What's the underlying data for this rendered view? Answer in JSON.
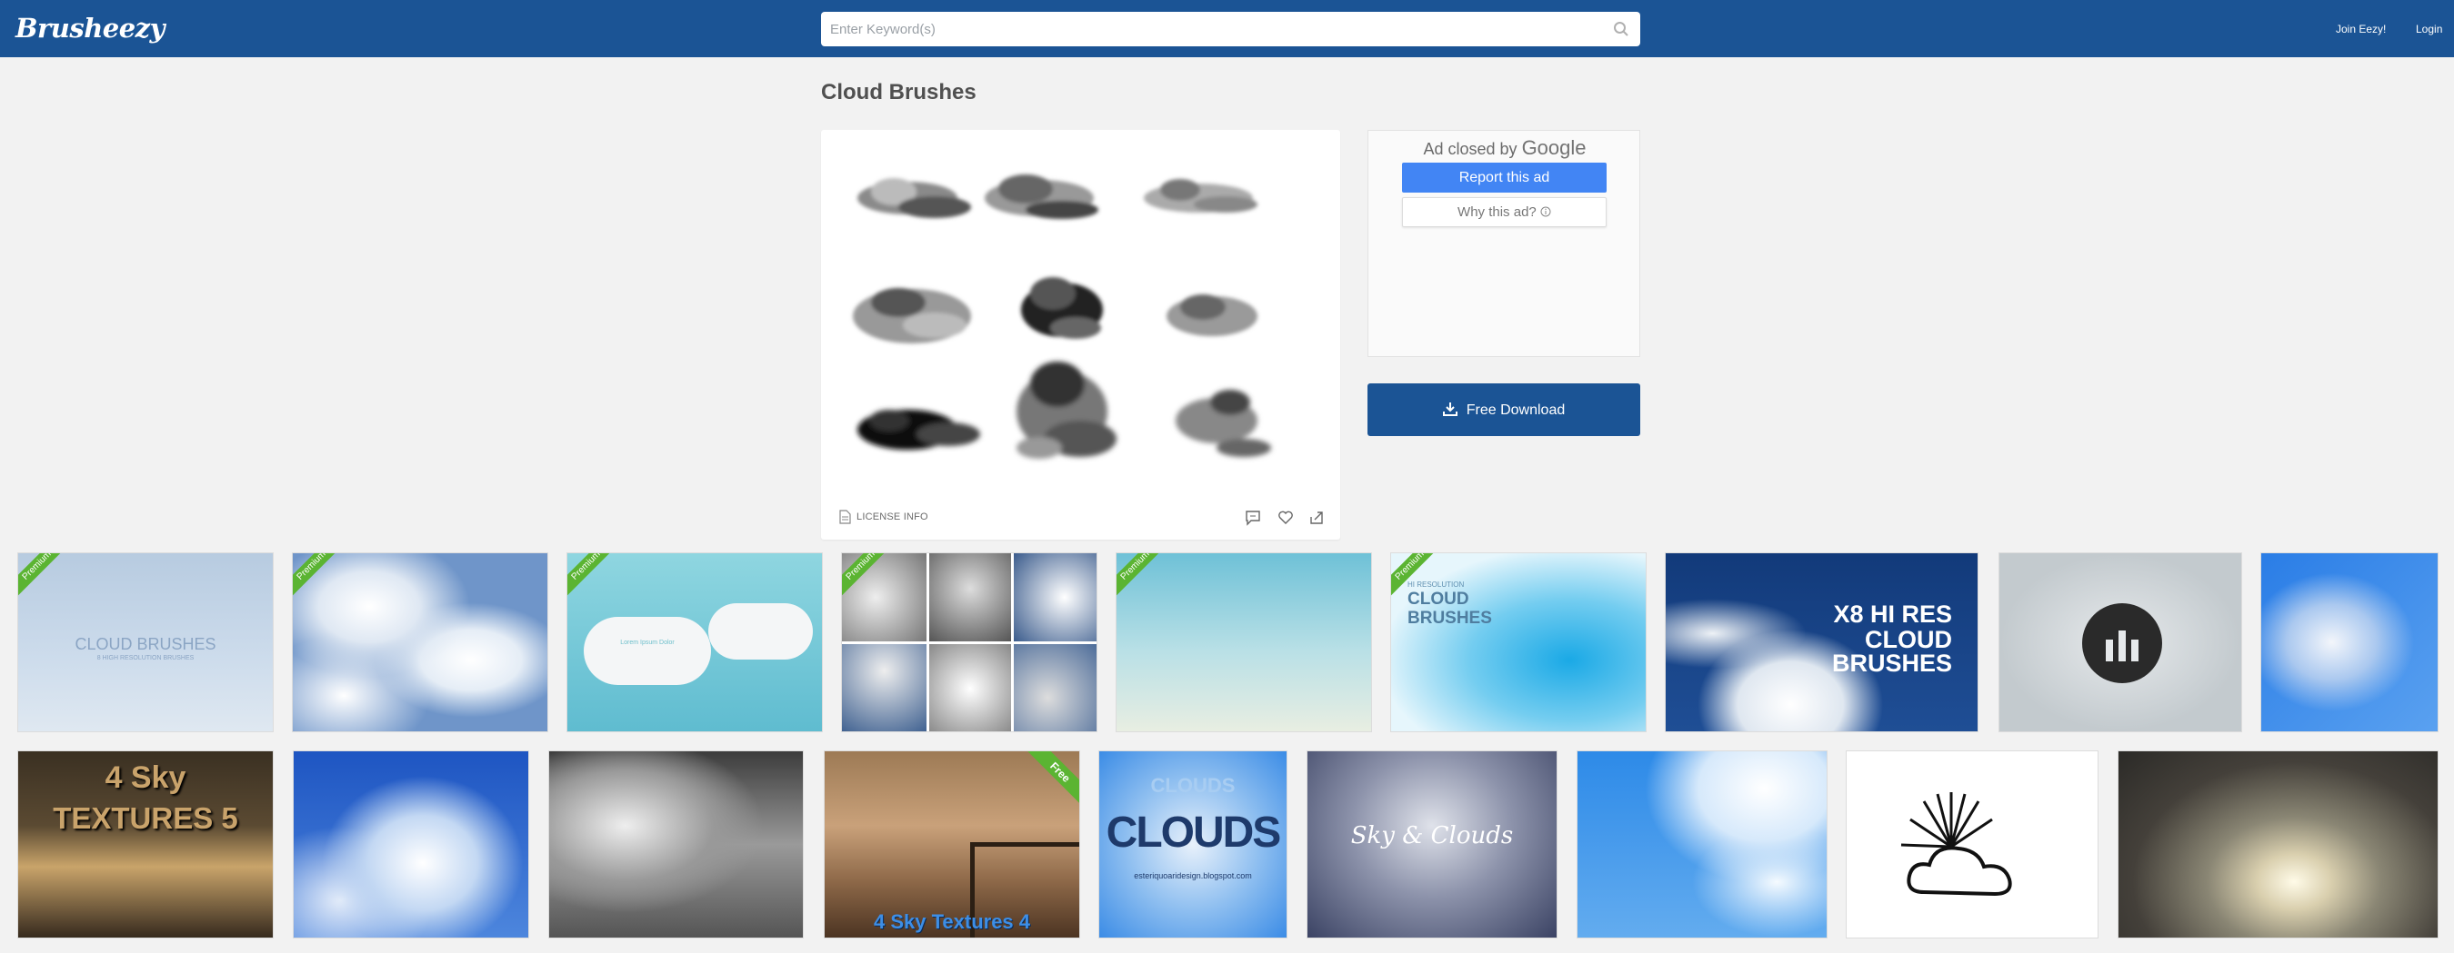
{
  "header": {
    "logo": "Brusheezy",
    "search_placeholder": "Enter Keyword(s)",
    "join_label": "Join Eezy!",
    "login_label": "Login"
  },
  "page": {
    "title": "Cloud Brushes"
  },
  "preview": {
    "license_label": "LICENSE INFO"
  },
  "ad": {
    "closed_by": "Ad closed by",
    "google": "Google",
    "report_label": "Report this ad",
    "why_label": "Why this ad?"
  },
  "download": {
    "label": "Free Download"
  },
  "badges": {
    "premium": "Premium",
    "free": "Free"
  },
  "thumbnails_row1_text": {
    "t1_title": "CLOUD BRUSHES",
    "t1_sub": "8 HIGH RESOLUTION BRUSHES",
    "t3_title": "Lorem Ipsum Dolor",
    "t6_line1": "HI RESOLUTION",
    "t6_line2": "CLOUD",
    "t6_line3": "BRUSHES",
    "t7_line1": "X8 HI RES",
    "t7_line2": "CLOUD",
    "t7_line3": "BRUSHES"
  },
  "thumbnails_row2_text": {
    "t1_line1": "4 Sky",
    "t1_line2": "TEXTURES 5",
    "t4_caption": "4 Sky Textures 4",
    "t5_top": "CLOUDS",
    "t5_title": "CLOUDS",
    "t5_url": "esteriquoaridesign.blogspot.com",
    "t6_title": "Sky & Clouds"
  },
  "colors": {
    "brand": "#1b5495",
    "report": "#4285f4",
    "badge": "#5bb432"
  },
  "icons": [
    "search-icon",
    "document-icon",
    "comment-icon",
    "heart-icon",
    "share-icon",
    "download-icon",
    "info-icon"
  ]
}
